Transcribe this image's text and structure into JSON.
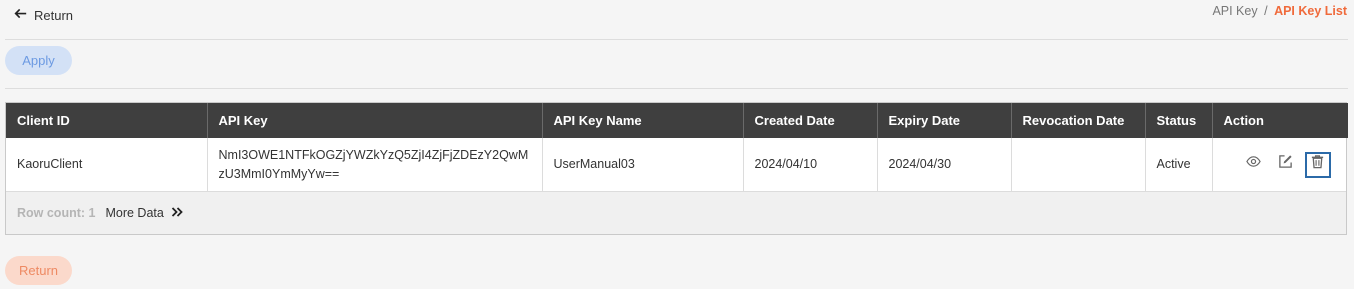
{
  "header": {
    "return_label": "Return",
    "breadcrumb": {
      "parent": "API Key",
      "separator": "/",
      "current": "API Key List"
    }
  },
  "toolbar": {
    "apply_label": "Apply"
  },
  "table": {
    "columns": [
      "Client ID",
      "API Key",
      "API Key Name",
      "Created Date",
      "Expiry Date",
      "Revocation Date",
      "Status",
      "Action"
    ],
    "rows": [
      {
        "client_id": "KaoruClient",
        "api_key": "NmI3OWE1NTFkOGZjYWZkYzQ5ZjI4ZjFjZDEzY2QwMzU3MmI0YmMyYw==",
        "api_key_name": "UserManual03",
        "created_date": "2024/04/10",
        "expiry_date": "2024/04/30",
        "revocation_date": "",
        "status": "Active",
        "actions": [
          "eye-icon",
          "edit-icon",
          "trash-icon"
        ]
      }
    ],
    "footer": {
      "row_count_label": "Row count: 1",
      "more_data_label": "More Data"
    }
  },
  "bottom": {
    "return_label": "Return"
  },
  "colors": {
    "accent_orange": "#f06a3b",
    "header_bg": "#3f3f3f",
    "apply_bg": "#d3e1f6",
    "return_bg": "#fbd9cb"
  }
}
